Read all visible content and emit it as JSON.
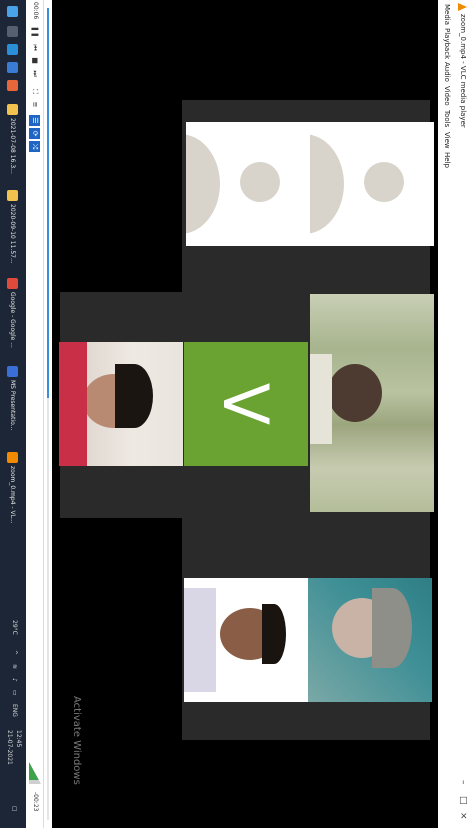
{
  "window": {
    "title": "zoom_0.mp4 - VLC media player",
    "controls": [
      "–",
      "□",
      "×"
    ]
  },
  "menu": [
    "Media",
    "Playback",
    "Audio",
    "Video",
    "Tools",
    "View",
    "Help"
  ],
  "video": {
    "avatar_letter": "V",
    "watermark": "Activate Windows"
  },
  "player": {
    "elapsed": "00:06",
    "remaining": "-00:23",
    "progress_fraction": 0.48
  },
  "taskbar": {
    "items": [
      {
        "label": "2021-07-08 16.3...",
        "color": "#f2c14e"
      },
      {
        "label": "2020-09-10 11.57...",
        "color": "#f2c14e"
      },
      {
        "label": "Google - Google ...",
        "color": "#e04a3a"
      },
      {
        "label": "MS Presentatio...",
        "color": "#3b6fd8"
      },
      {
        "label": "zoom_0.mp4 - VL...",
        "color": "#f08a00"
      }
    ],
    "tray_temp": "29°C",
    "time": "12:45",
    "date": "21-07-2021"
  }
}
